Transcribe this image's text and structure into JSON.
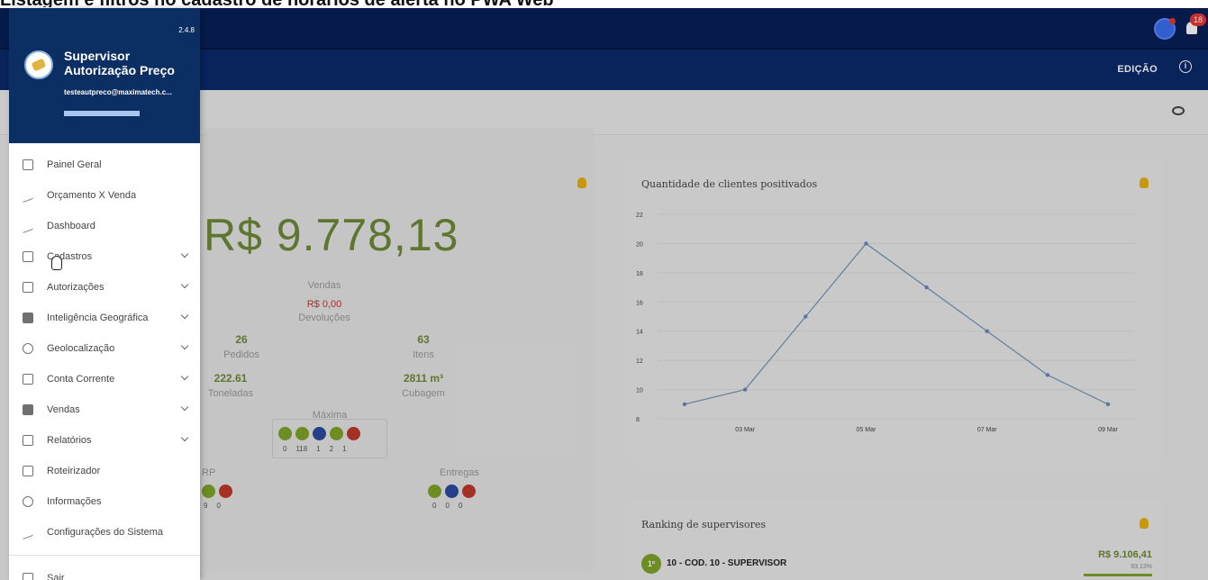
{
  "doc_title": "Listagem e filtros no cadastro de horários de alerta no PWA Web",
  "drawer": {
    "version": "2.4.8",
    "app_name": "Supervisor Autorização Preço",
    "email": "testeautpreco@maximatech.c...",
    "menu": [
      {
        "label": "Painel Geral",
        "icon": "grid-icon",
        "expandable": false
      },
      {
        "label": "Orçamento X Venda",
        "icon": "chart-bars-icon",
        "expandable": false
      },
      {
        "label": "Dashboard",
        "icon": "trend-icon",
        "expandable": false
      },
      {
        "label": "Cadastros",
        "icon": "edit-box-icon",
        "expandable": true
      },
      {
        "label": "Autorizações",
        "icon": "checkbox-icon",
        "expandable": true
      },
      {
        "label": "Inteligência Geográfica",
        "icon": "document-icon",
        "expandable": true
      },
      {
        "label": "Geolocalização",
        "icon": "location-pin-icon",
        "expandable": true
      },
      {
        "label": "Conta Corrente",
        "icon": "bank-icon",
        "expandable": true
      },
      {
        "label": "Vendas",
        "icon": "document-icon",
        "expandable": true
      },
      {
        "label": "Relatórios",
        "icon": "report-icon",
        "expandable": true
      },
      {
        "label": "Roteirizador",
        "icon": "map-icon",
        "expandable": false
      },
      {
        "label": "Informações",
        "icon": "info-icon",
        "expandable": false
      },
      {
        "label": "Configurações do Sistema",
        "icon": "settings-icon",
        "expandable": false
      }
    ],
    "logout": "Sair"
  },
  "header": {
    "edit_label": "EDIÇÃO",
    "notifications_count": "18"
  },
  "dashboard": {
    "total_value": "R$ 9.778,13",
    "vendas_label": "Vendas",
    "devolucoes_value": "R$ 0,00",
    "devolucoes_label": "Devoluções",
    "pedidos_value": "26",
    "pedidos_label": "Pedidos",
    "itens_value": "63",
    "itens_label": "Itens",
    "toneladas_value": "222.61",
    "toneladas_label": "Toneladas",
    "cubagem_value": "2811 m³",
    "cubagem_label": "Cubagem",
    "maxima_label": "Máxima",
    "maxima_counts": [
      "0",
      "118",
      "1",
      "2",
      "1"
    ],
    "erp_label": "RP",
    "erp_counts": [
      "9",
      "0"
    ],
    "entregas_label": "Entregas",
    "entregas_counts": [
      "0",
      "0",
      "0"
    ]
  },
  "chart_data": {
    "type": "line",
    "title": "Quantidade de clientes positivados",
    "x": [
      "02 Mar",
      "03 Mar",
      "04 Mar",
      "05 Mar",
      "06 Mar",
      "07 Mar",
      "08 Mar",
      "09 Mar"
    ],
    "x_tick_labels": [
      "03 Mar",
      "05 Mar",
      "07 Mar",
      "09 Mar"
    ],
    "series": [
      {
        "values": [
          9,
          10,
          15,
          20,
          17,
          14,
          11,
          9
        ]
      }
    ],
    "ylim": [
      8,
      22
    ],
    "y_ticks": [
      8,
      10,
      12,
      14,
      16,
      18,
      20,
      22
    ]
  },
  "ranking": {
    "title": "Ranking de supervisores",
    "position": "1º",
    "name": "10 - COD. 10 - SUPERVISOR",
    "value": "R$ 9.106,41",
    "percent": "93,13%"
  }
}
